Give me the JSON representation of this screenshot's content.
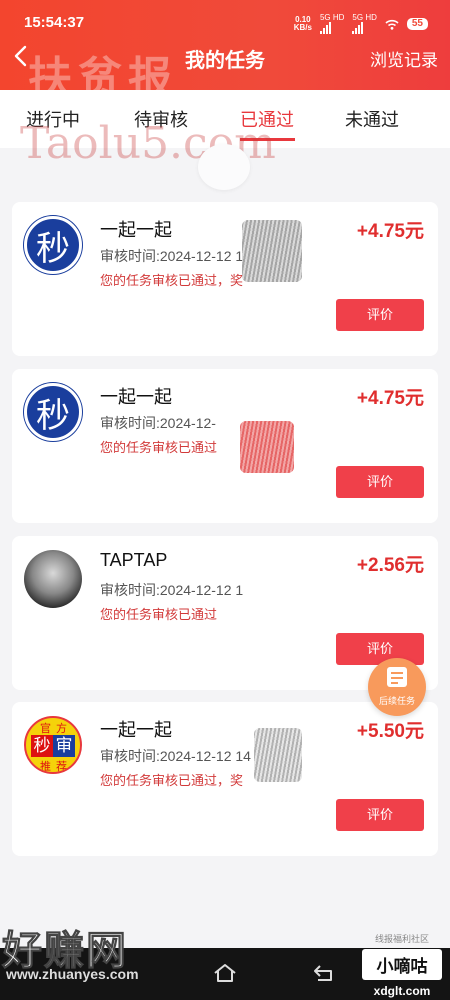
{
  "status_bar": {
    "time": "15:54:37",
    "net_speed_value": "0.10",
    "net_speed_unit": "KB/s",
    "sim1": "5G HD",
    "sim2": "5G HD",
    "battery": "55"
  },
  "header": {
    "title": "我的任务",
    "history_label": "浏览记录"
  },
  "tabs": [
    {
      "label": "进行中"
    },
    {
      "label": "待审核"
    },
    {
      "label": "已通过"
    },
    {
      "label": "未通过"
    }
  ],
  "active_tab": "已通过",
  "watermarks": {
    "top": "扶贫报",
    "mid": "Taolu5.com",
    "bottom_big": "好赚网",
    "bottom_url": "www.zhuanyes.com",
    "right_small": "线报福利社区",
    "right_box": "小嘀咕",
    "right_url": "xdglt.com"
  },
  "tasks": [
    {
      "name": "一起一起",
      "reward": "+4.75元",
      "review_time": "审核时间:2024-12-12 1",
      "status": "您的任务审核已通过，奖",
      "rate_label": "评价"
    },
    {
      "name": "一起一起",
      "reward": "+4.75元",
      "review_time": "审核时间:2024-12-",
      "status": "您的任务审核已通过",
      "rate_label": "评价"
    },
    {
      "name": "TAPTAP",
      "reward": "+2.56元",
      "review_time": "审核时间:2024-12-12 1",
      "status": "您的任务审核已通过",
      "rate_label": "评价"
    },
    {
      "name": "一起一起",
      "reward": "+5.50元",
      "review_time": "审核时间:2024-12-12 14",
      "status": "您的任务审核已通过，奖",
      "rate_label": "评价"
    }
  ],
  "avatar_texts": {
    "miao": "秒",
    "official_tl": "官",
    "official_tr": "方",
    "official_l": "秒",
    "official_r": "审",
    "official_bl": "推",
    "official_br": "荐"
  },
  "float_button": {
    "label": "后续任务"
  },
  "colors": {
    "accent": "#e8383d",
    "header": "#f04a3a",
    "reward": "#e02e2e",
    "button": "#f0404a"
  }
}
